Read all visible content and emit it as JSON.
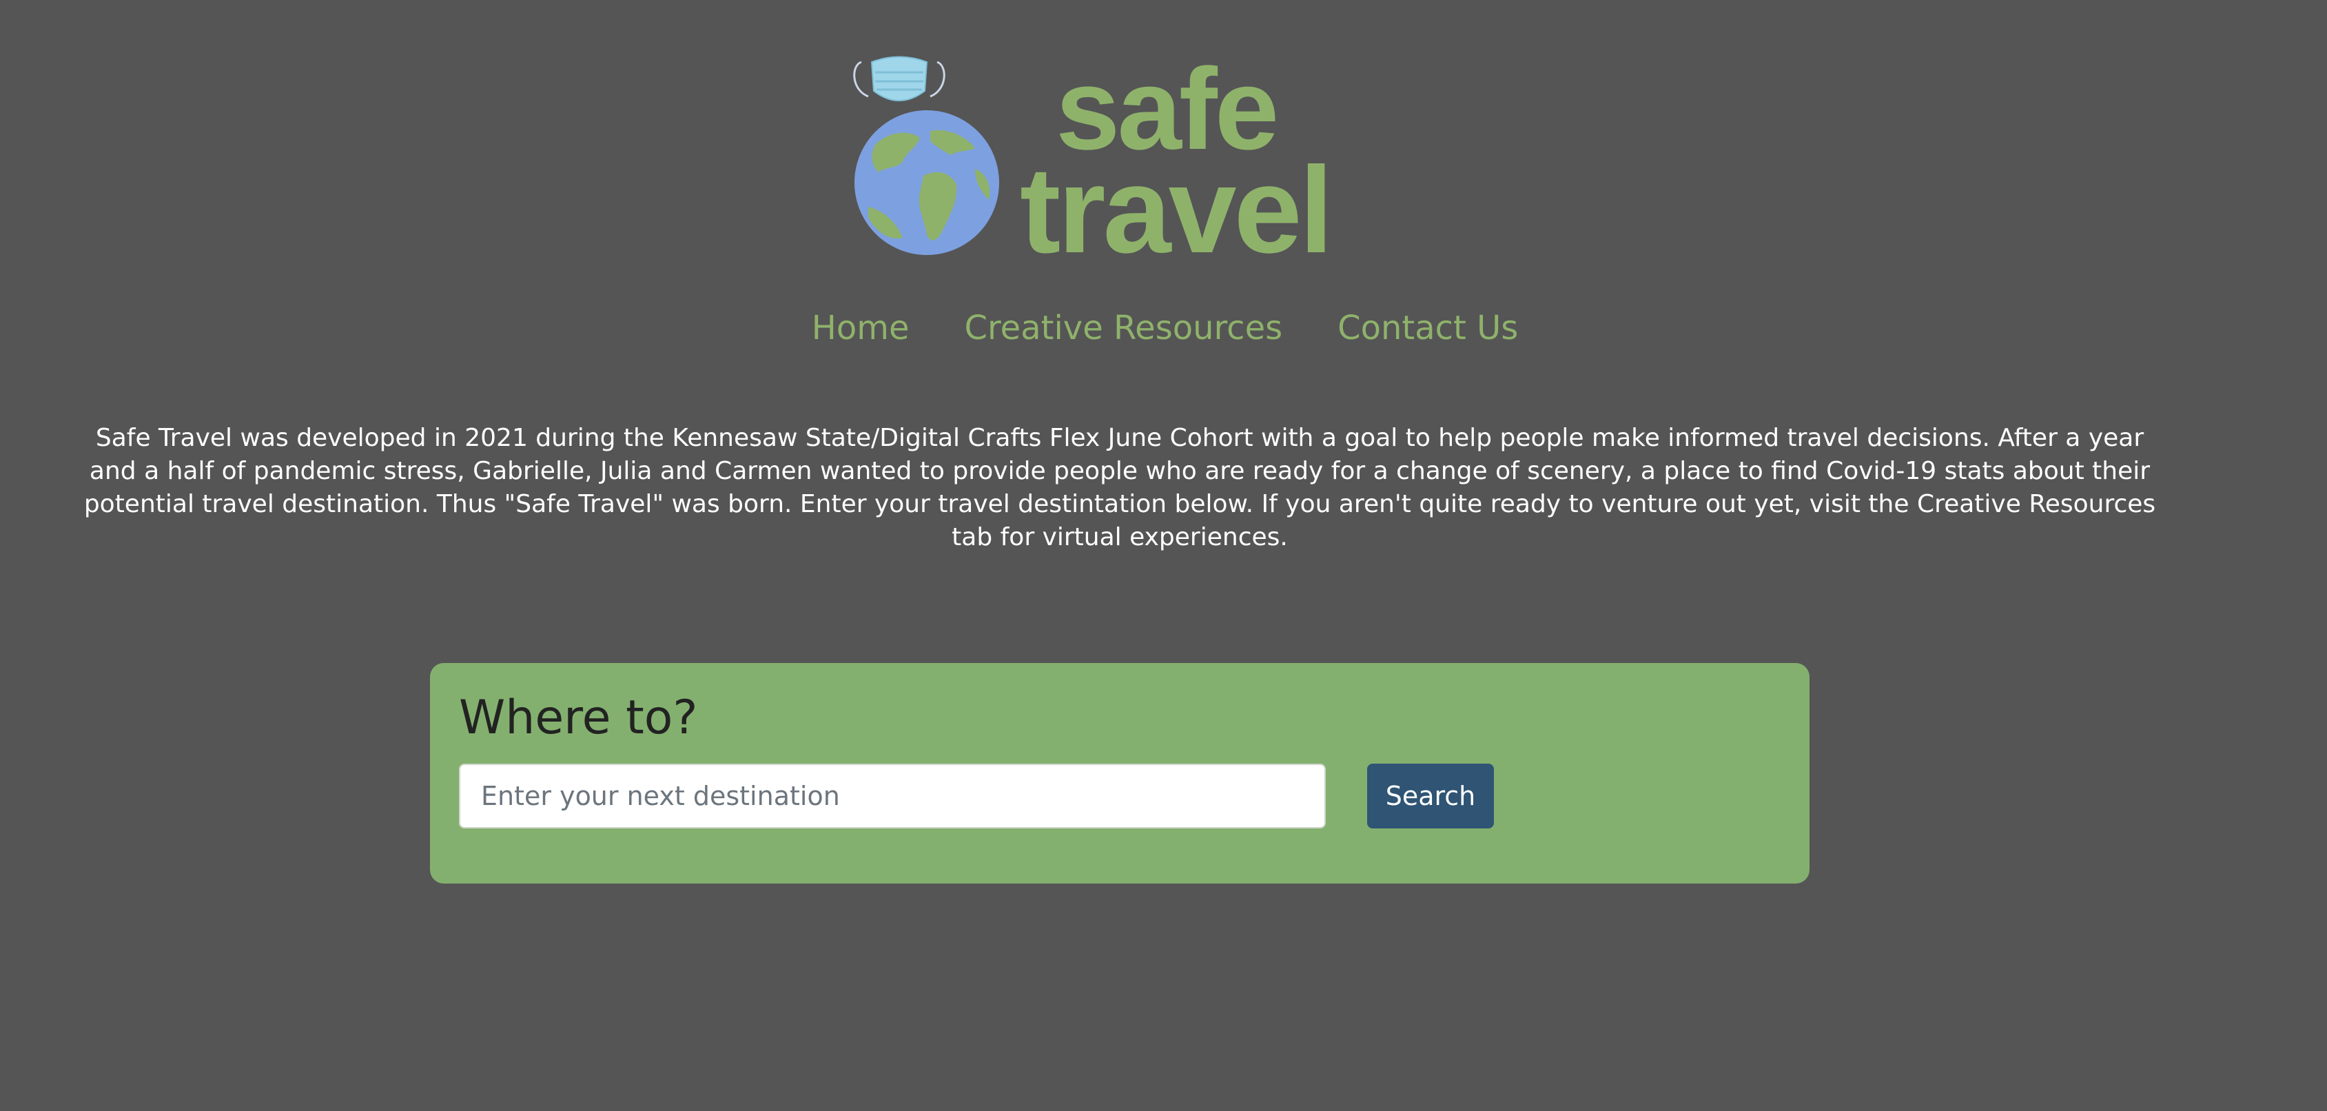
{
  "logo": {
    "word_top": "safe",
    "word_bottom": "travel",
    "globe_icon": "earth-globe-icon",
    "mask_icon": "face-mask-icon",
    "brand_green": "#8fb26b",
    "globe_blue": "#7da0e0"
  },
  "nav": {
    "items": [
      {
        "label": "Home"
      },
      {
        "label": "Creative Resources"
      },
      {
        "label": "Contact Us"
      }
    ]
  },
  "intro": {
    "text": "Safe Travel was developed in 2021 during the Kennesaw State/Digital Crafts Flex June Cohort with a goal to help people make informed travel decisions. After a year and a half of pandemic stress, Gabrielle, Julia and Carmen wanted to provide people who are ready for a change of scenery, a place to find Covid-19 stats about their potential travel destination. Thus \"Safe Travel\" was born. Enter your travel destintation below. If you aren't quite ready to venture out yet, visit the Creative Resources tab for virtual experiences."
  },
  "search": {
    "heading": "Where to?",
    "placeholder": "Enter your next destination",
    "value": "",
    "button_label": "Search"
  },
  "colors": {
    "background": "#555555",
    "card": "#84b06f",
    "button": "#2f5474"
  }
}
